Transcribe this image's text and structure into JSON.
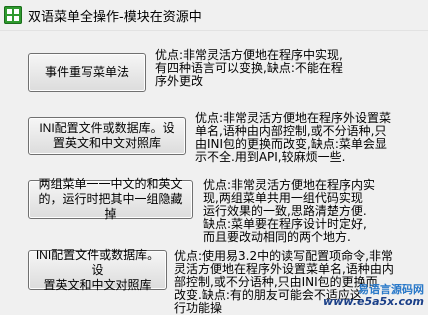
{
  "window": {
    "title": "双语菜单全操作-模块在资源中"
  },
  "rows": [
    {
      "button": "事件重写菜单法",
      "desc": "优点:非常灵活方便地在程序中实现,\n有四种语言可以变换,缺点:不能在程\n序外更改"
    },
    {
      "button": "INI配置文件或数据库。设\n置英文和中文对照库",
      "desc": "优点:非常灵活方便地在程序外设置菜\n单名,语种由内部控制,或不分语种,只\n由INI包的更换而改变,缺点:菜单会显\n示不全.用到API,较麻烦一些."
    },
    {
      "button": "两组菜单一一中文的和英文\n的，运行时把其中一组隐藏掉",
      "desc": "优点:非常灵活方便地在程序内实\n现,两组菜单共用一组代码实现\n运行效果的一致,思路清楚方便.\n缺点:菜单要在程序设计时定好,\n而且要改动相同的两个地方."
    },
    {
      "button": "INI配置文件或数据库。设\n置英文和中文对照库",
      "desc": "优点:使用易3.2中的读写配置项命令,非常\n灵活方便地在程序外设置菜单名,语种由内\n部控制,或不分语种,只由INI包的更换而\n改变.缺点:有的朋友可能会不适应这\n行功能操"
    }
  ],
  "watermark": {
    "top": "易语言源码网",
    "bottom": "www.e5a5x.com"
  },
  "colors": {
    "window_bg": "#f0f0f0",
    "icon": "#2f9a2f",
    "watermark_top": "#2a79c9",
    "watermark_bottom": "#1a3f88"
  }
}
